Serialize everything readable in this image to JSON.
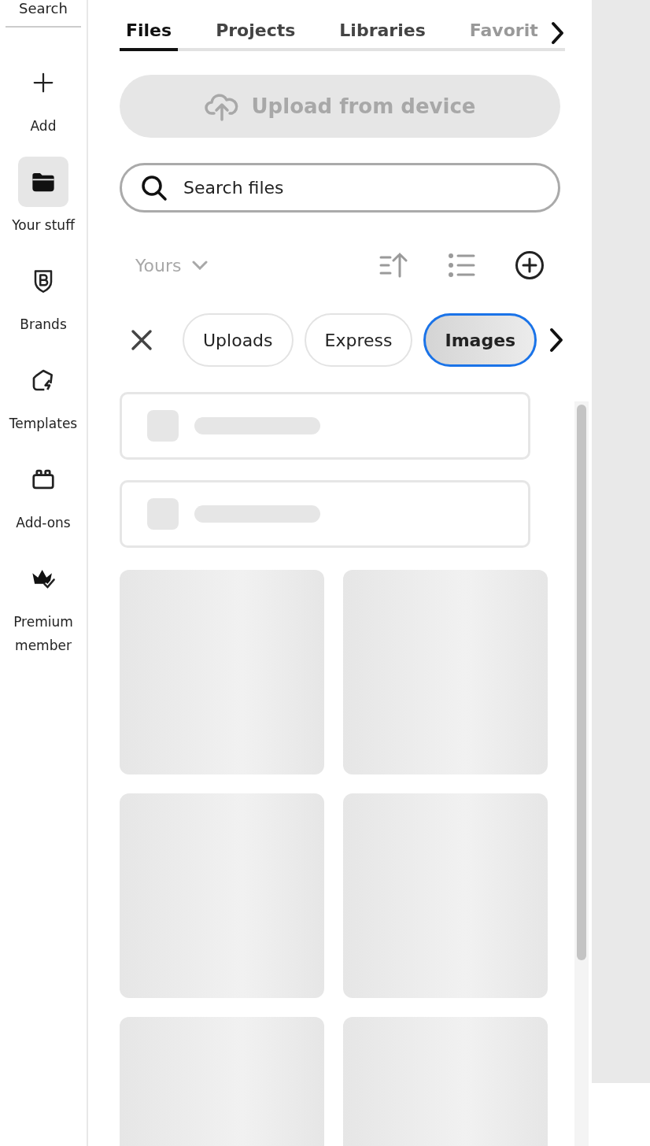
{
  "sidebar": {
    "search_label": "Search",
    "items": [
      {
        "kind": "plus",
        "label": "Add",
        "selected": false
      },
      {
        "kind": "folder",
        "label": "Your stuff",
        "selected": true
      },
      {
        "kind": "brand",
        "label": "Brands",
        "selected": false
      },
      {
        "kind": "template",
        "label": "Templates",
        "selected": false
      },
      {
        "kind": "addon",
        "label": "Add-ons",
        "selected": false
      },
      {
        "kind": "crown",
        "label": "Premium member",
        "selected": false
      }
    ]
  },
  "tabs": [
    {
      "label": "Files",
      "selected": true
    },
    {
      "label": "Projects",
      "selected": false
    },
    {
      "label": "Libraries",
      "selected": false
    },
    {
      "label": "Favorit",
      "selected": false
    }
  ],
  "upload_button": {
    "label": "Upload from device",
    "disabled": true
  },
  "search": {
    "placeholder": "Search files"
  },
  "toolbar": {
    "filter": {
      "label": "Yours",
      "disabled": true
    },
    "tools": [
      {
        "kind": "sort",
        "disabled": true
      },
      {
        "kind": "list",
        "disabled": true
      },
      {
        "kind": "add",
        "disabled": false
      }
    ]
  },
  "chips": [
    {
      "label": "Uploads",
      "selected": false
    },
    {
      "label": "Express",
      "selected": false
    },
    {
      "label": "Images",
      "selected": true
    }
  ],
  "skeleton_rows": [
    {
      "kind": "row"
    },
    {
      "kind": "row"
    }
  ],
  "skeleton_tiles": [
    {
      "kind": "tile"
    },
    {
      "kind": "tile"
    },
    {
      "kind": "tile"
    },
    {
      "kind": "tile"
    },
    {
      "kind": "tile"
    },
    {
      "kind": "tile"
    }
  ]
}
